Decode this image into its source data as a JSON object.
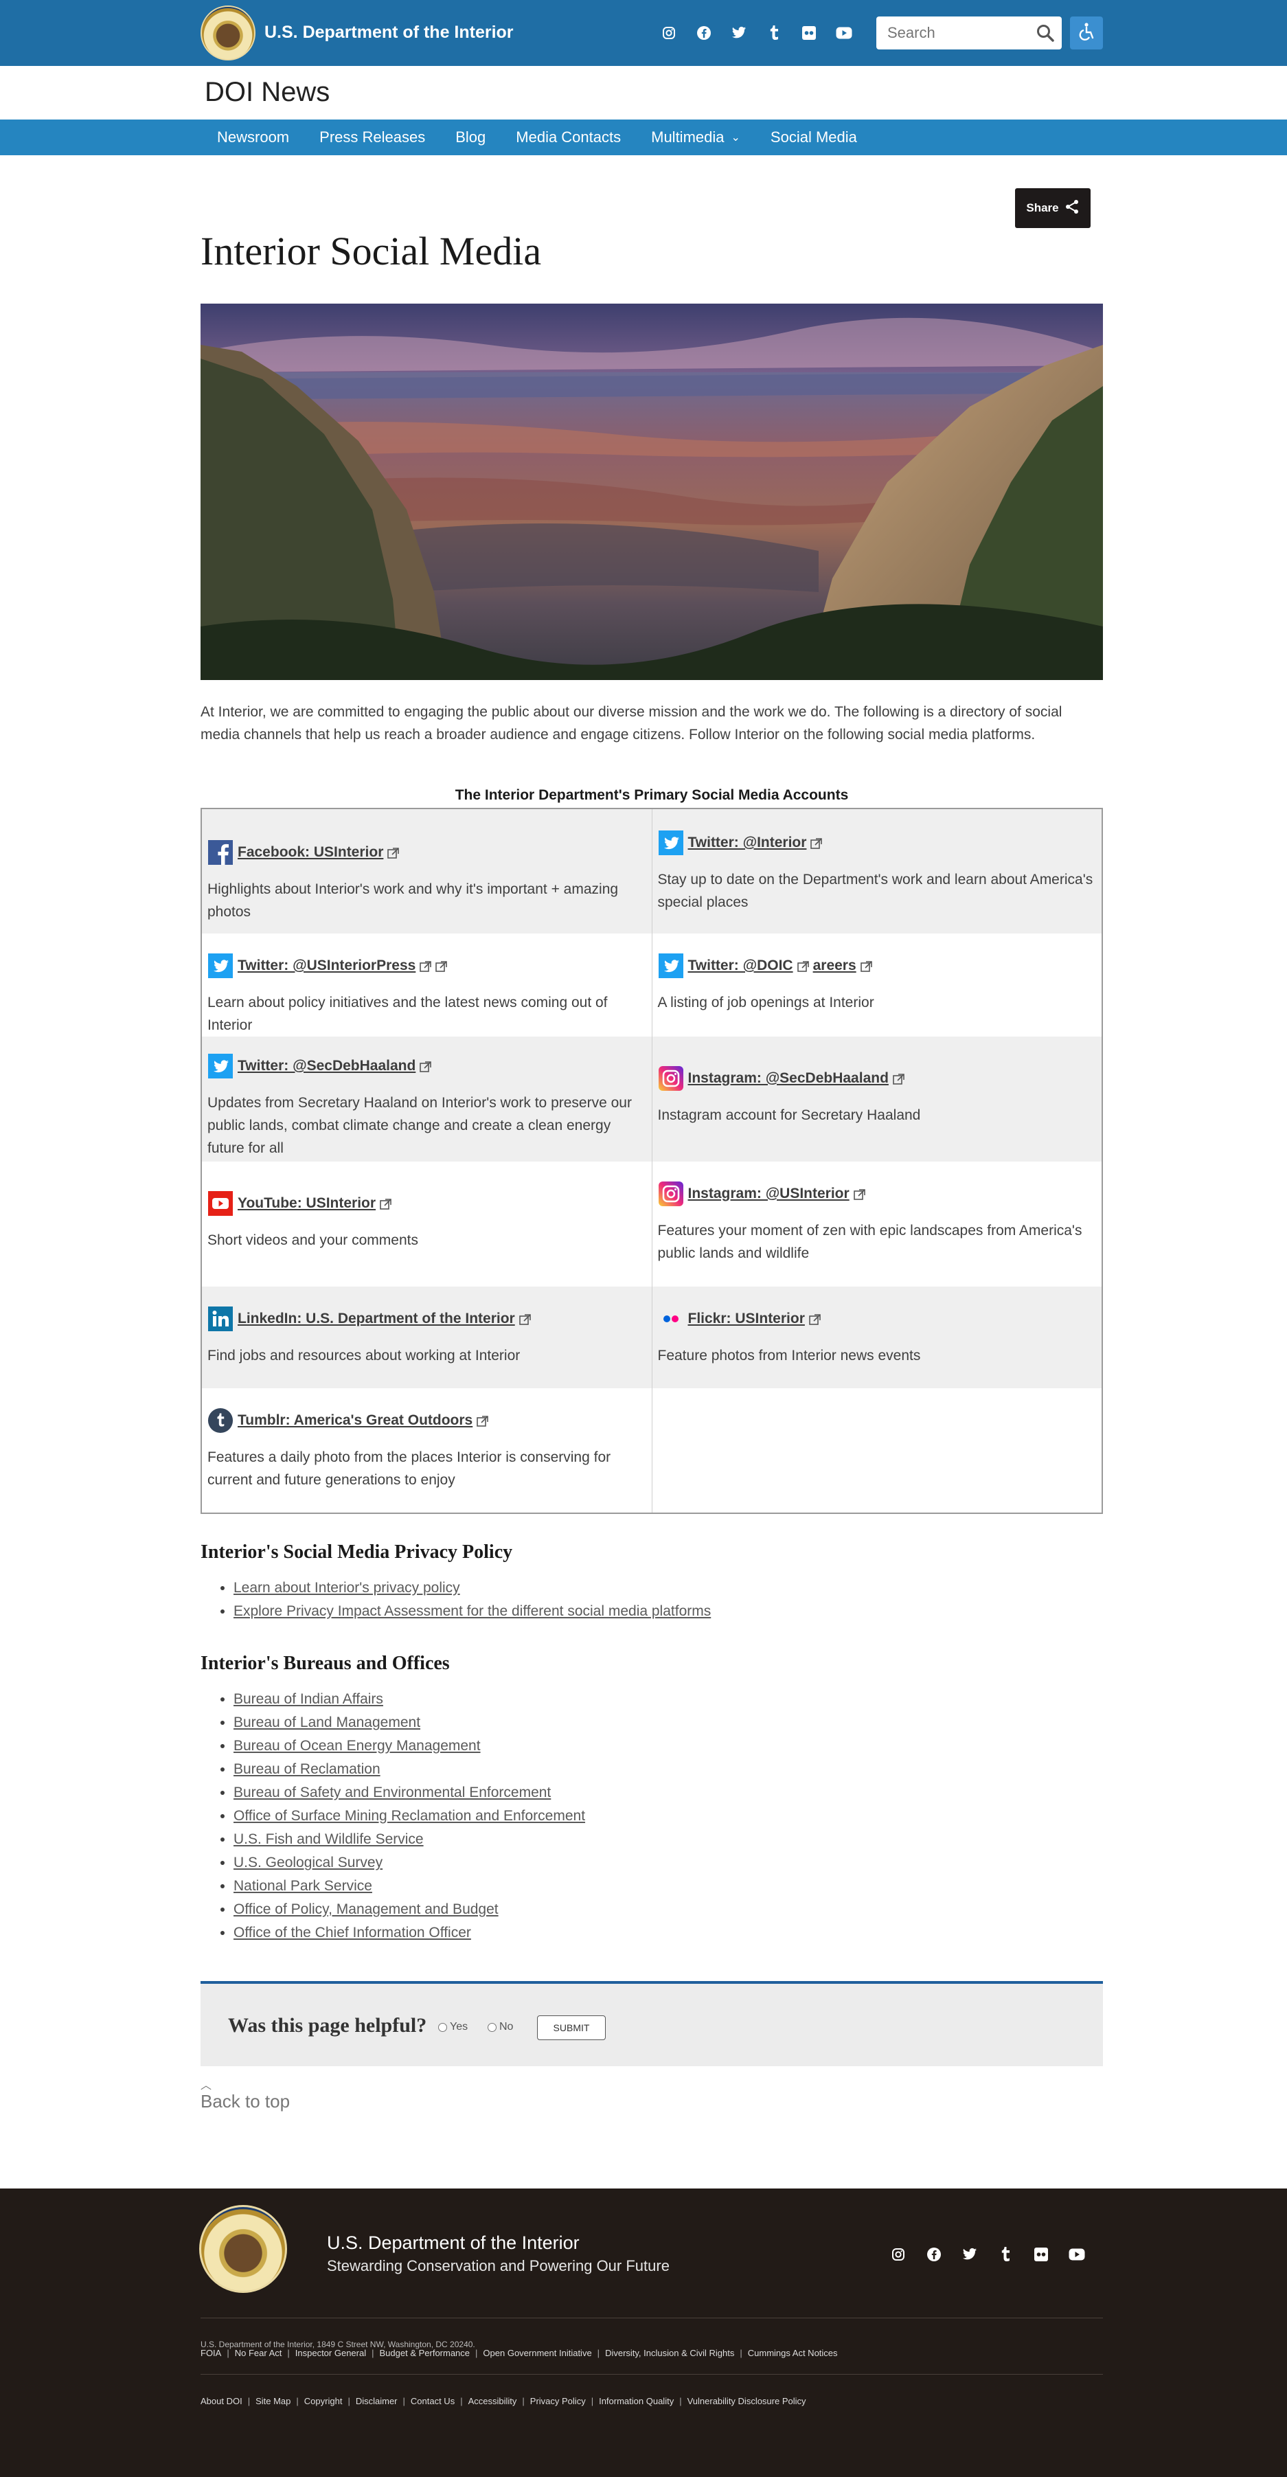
{
  "header": {
    "agency_title": "U.S. Department of the Interior",
    "social_icons": [
      "instagram-icon",
      "facebook-icon",
      "twitter-icon",
      "tumblr-icon",
      "flickr-icon",
      "youtube-icon"
    ],
    "search_placeholder": "Search",
    "accessibility_icon": "accessibility-icon"
  },
  "site_name": "DOI News",
  "nav": {
    "items": [
      "Newsroom",
      "Press Releases",
      "Blog",
      "Media Contacts",
      "Multimedia",
      "Social Media"
    ]
  },
  "share_label": "Share",
  "page_title": "Interior Social Media",
  "intro": "At Interior, we are committed to engaging the public about our diverse mission and the work we do. The following is a directory of social media channels that help us reach a broader audience and engage citizens. Follow Interior on the following social media platforms.",
  "table": {
    "caption": "The Interior Department's Primary Social Media Accounts",
    "rows": [
      [
        {
          "icon": "facebook-icon",
          "account": "Facebook: USInterior",
          "desc": "Highlights about Interior's work and why it's important + amazing photos"
        },
        {
          "icon": "twitter-icon",
          "account": "Twitter: @Interior",
          "desc": "Stay up to date on the Department's work and learn about America's special places"
        }
      ],
      [
        {
          "icon": "twitter-icon",
          "account": "Twitter: @USInteriorPress",
          "desc": "Learn about policy initiatives and the latest news coming out of Interior"
        },
        {
          "icon": "twitter-icon",
          "account": "Twitter: @DOIC",
          "account_extra": "areers",
          "desc": "A listing of job openings at Interior"
        }
      ],
      [
        {
          "icon": "twitter-icon",
          "account": "Twitter: @SecDebHaaland",
          "desc": "Updates from Secretary Haaland on Interior's work to preserve our public lands, combat climate change and create a clean energy future for all"
        },
        {
          "icon": "instagram-icon",
          "account": "Instagram: @SecDebHaaland",
          "desc": "Instagram account for Secretary Haaland"
        }
      ],
      [
        {
          "icon": "youtube-icon",
          "account": "YouTube: USInterior",
          "desc": "Short videos and your comments"
        },
        {
          "icon": "instagram-icon",
          "account": "Instagram: @USInterior",
          "desc": "Features your moment of zen with epic landscapes from America's public lands and wildlife"
        }
      ],
      [
        {
          "icon": "linkedin-icon",
          "account": "LinkedIn: U.S. Department of the Interior",
          "desc": "Find jobs and resources about working at Interior"
        },
        {
          "icon": "flickr-icon",
          "account": "Flickr: USInterior",
          "desc": "Feature photos from Interior news events"
        }
      ],
      [
        {
          "icon": "tumblr-icon",
          "account": "Tumblr: America's Great Outdoors",
          "desc": "Features a daily photo from the places Interior is conserving for current and future generations to enjoy"
        },
        null
      ]
    ]
  },
  "privacy": {
    "heading": "Interior's Social Media Privacy Policy",
    "links": [
      "Learn about Interior's privacy policy",
      "Explore Privacy Impact Assessment for the different social media platforms"
    ]
  },
  "bureaus": {
    "heading": "Interior's Bureaus and Offices",
    "links": [
      "Bureau of Indian Affairs",
      "Bureau of Land Management",
      "Bureau of Ocean Energy Management",
      "Bureau of Reclamation",
      "Bureau of Safety and Environmental Enforcement",
      "Office of Surface Mining Reclamation and Enforcement",
      "U.S. Fish and Wildlife Service",
      "U.S. Geological Survey",
      "National Park Service",
      "Office of Policy, Management and Budget",
      "Office of the Chief Information Officer"
    ]
  },
  "feedback": {
    "question": "Was this page helpful?",
    "yes": "Yes",
    "no": "No",
    "submit": "SUBMIT"
  },
  "back_to_top": "Back to top",
  "footer": {
    "org": "U.S. Department of the Interior",
    "tagline": "Stewarding Conservation and Powering Our Future",
    "links_row1": [
      "FOIA",
      "No Fear Act",
      "Inspector General",
      "Budget & Performance",
      "Open Government Initiative",
      "Diversity, Inclusion & Civil Rights",
      "Cummings Act Notices"
    ],
    "links_row2": [
      "About DOI",
      "Site Map",
      "Copyright",
      "Disclaimer",
      "Contact Us",
      "Accessibility",
      "Privacy Policy",
      "Information Quality",
      "Vulnerability Disclosure Policy"
    ],
    "address": "U.S. Department of the Interior, 1849 C Street NW, Washington, DC 20240."
  },
  "colors": {
    "topbar": "#1f6ea5",
    "navbar": "#2585c0",
    "footer": "#221b17",
    "twitter": "#1da1f2",
    "facebook": "#3b5998",
    "youtube": "#e62117",
    "linkedin": "#0e76a8"
  }
}
